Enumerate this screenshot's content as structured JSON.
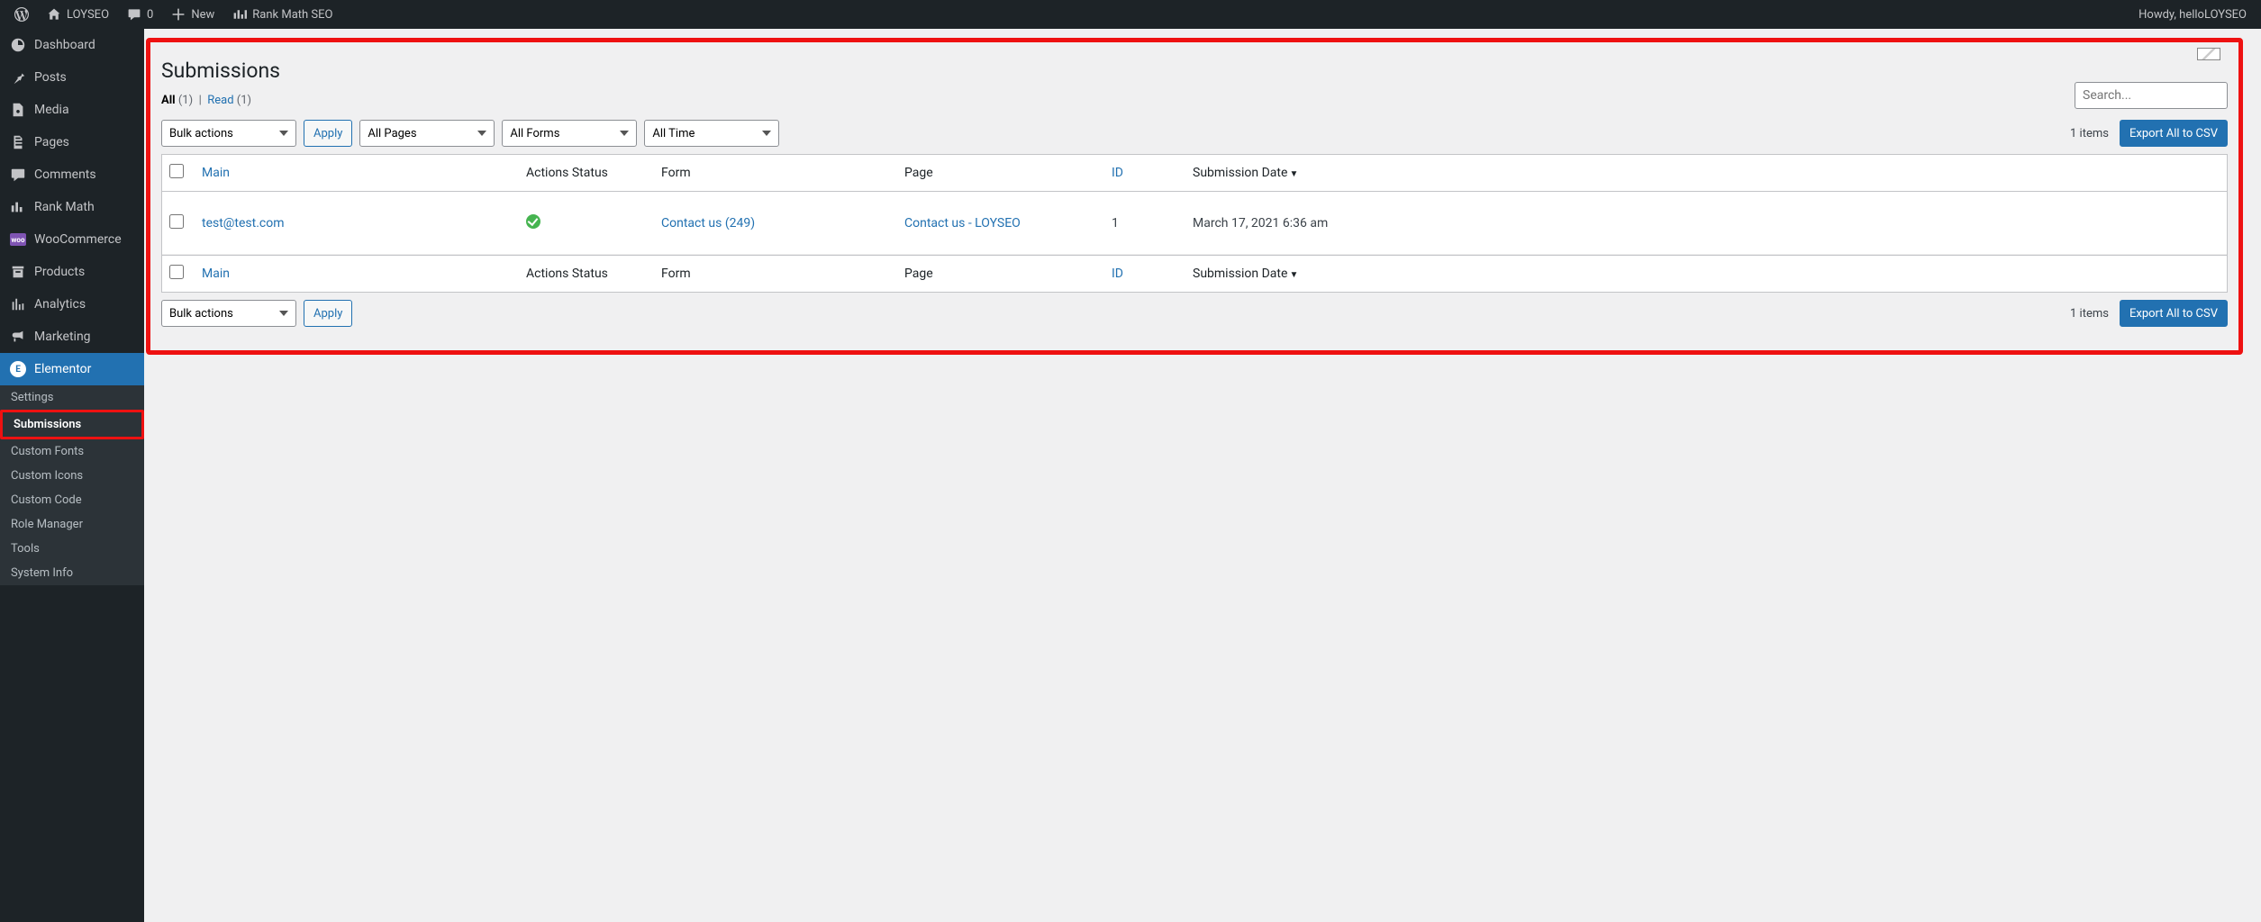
{
  "adminbar": {
    "site_name": "LOYSEO",
    "comments_count": "0",
    "new_label": "New",
    "rankmath_label": "Rank Math SEO",
    "howdy": "Howdy, helloLOYSEO"
  },
  "sidebar": {
    "items": [
      {
        "label": "Dashboard",
        "icon": "dashboard"
      },
      {
        "label": "Posts",
        "icon": "pin"
      },
      {
        "label": "Media",
        "icon": "media"
      },
      {
        "label": "Pages",
        "icon": "pages"
      },
      {
        "label": "Comments",
        "icon": "comment"
      },
      {
        "label": "Rank Math",
        "icon": "chart"
      },
      {
        "label": "WooCommerce",
        "icon": "woo"
      },
      {
        "label": "Products",
        "icon": "archive"
      },
      {
        "label": "Analytics",
        "icon": "bars"
      },
      {
        "label": "Marketing",
        "icon": "megaphone"
      },
      {
        "label": "Elementor",
        "icon": "elementor"
      }
    ],
    "submenu": [
      {
        "label": "Settings"
      },
      {
        "label": "Submissions"
      },
      {
        "label": "Custom Fonts"
      },
      {
        "label": "Custom Icons"
      },
      {
        "label": "Custom Code"
      },
      {
        "label": "Role Manager"
      },
      {
        "label": "Tools"
      },
      {
        "label": "System Info"
      }
    ]
  },
  "page": {
    "title": "Submissions",
    "views": {
      "all_label": "All",
      "all_count": "(1)",
      "sep": "|",
      "read_label": "Read",
      "read_count": "(1)"
    },
    "search_placeholder": "Search...",
    "bulk_actions_label": "Bulk actions",
    "apply_label": "Apply",
    "filter_pages": "All Pages",
    "filter_forms": "All Forms",
    "filter_time": "All Time",
    "items_count": "1 items",
    "export_label": "Export All to CSV",
    "columns": {
      "main": "Main",
      "status": "Actions Status",
      "form": "Form",
      "page": "Page",
      "id": "ID",
      "date": "Submission Date"
    },
    "rows": [
      {
        "main": "test@test.com",
        "status": "ok",
        "form": "Contact us (249)",
        "page": "Contact us - LOYSEO",
        "id": "1",
        "date": "March 17, 2021 6:36 am"
      }
    ]
  }
}
